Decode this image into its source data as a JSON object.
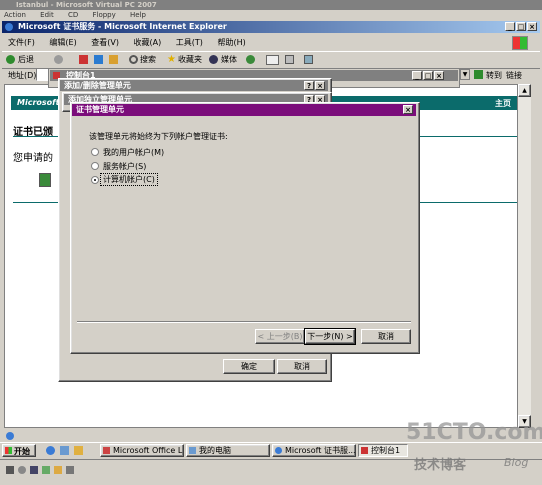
{
  "vpc": {
    "title": "Istanbul - Microsoft Virtual PC 2007",
    "menu": [
      "Action",
      "Edit",
      "CD",
      "Floppy",
      "Help"
    ]
  },
  "ie": {
    "title": "Microsoft 证书服务 - Microsoft Internet Explorer",
    "menu": [
      "文件(F)",
      "编辑(E)",
      "查看(V)",
      "收藏(A)",
      "工具(T)",
      "帮助(H)"
    ],
    "back": "后退",
    "search": "搜索",
    "favorites": "收藏夹",
    "media": "媒体",
    "address_label": "地址(D)",
    "go": "转到",
    "links": "链接",
    "banner_left": "Microsoft",
    "banner_right": "主页",
    "page_heading": "证书已颁",
    "page_text": "您申请的"
  },
  "console": {
    "title": "控制台1"
  },
  "addremove": {
    "title": "添加/删除管理单元"
  },
  "addstandalone": {
    "title": "添加独立管理单元"
  },
  "certsnap": {
    "title": "证书管理单元",
    "prompt": "该管理单元将始终为下列帐户管理证书:",
    "options": [
      "我的用户帐户(M)",
      "服务帐户(S)",
      "计算机帐户(C)"
    ],
    "selected": 2,
    "back_btn": "< 上一步(B)",
    "next_btn": "下一步(N) >",
    "cancel_btn": "取消"
  },
  "outer_buttons": {
    "ok": "确定",
    "cancel": "取消"
  },
  "taskbar": {
    "start": "开始",
    "items": [
      "Microsoft Office Li...",
      "我的电脑",
      "Microsoft 证书服...",
      "控制台1"
    ]
  },
  "watermark": {
    "main": "51CTO.com",
    "sub": "技术博客",
    "blog": "Blog"
  },
  "colors": {
    "title_active": "#7b0d7b",
    "title_ie": "#0a246a",
    "title_inactive": "#808080",
    "banner": "#0b6b6b"
  }
}
